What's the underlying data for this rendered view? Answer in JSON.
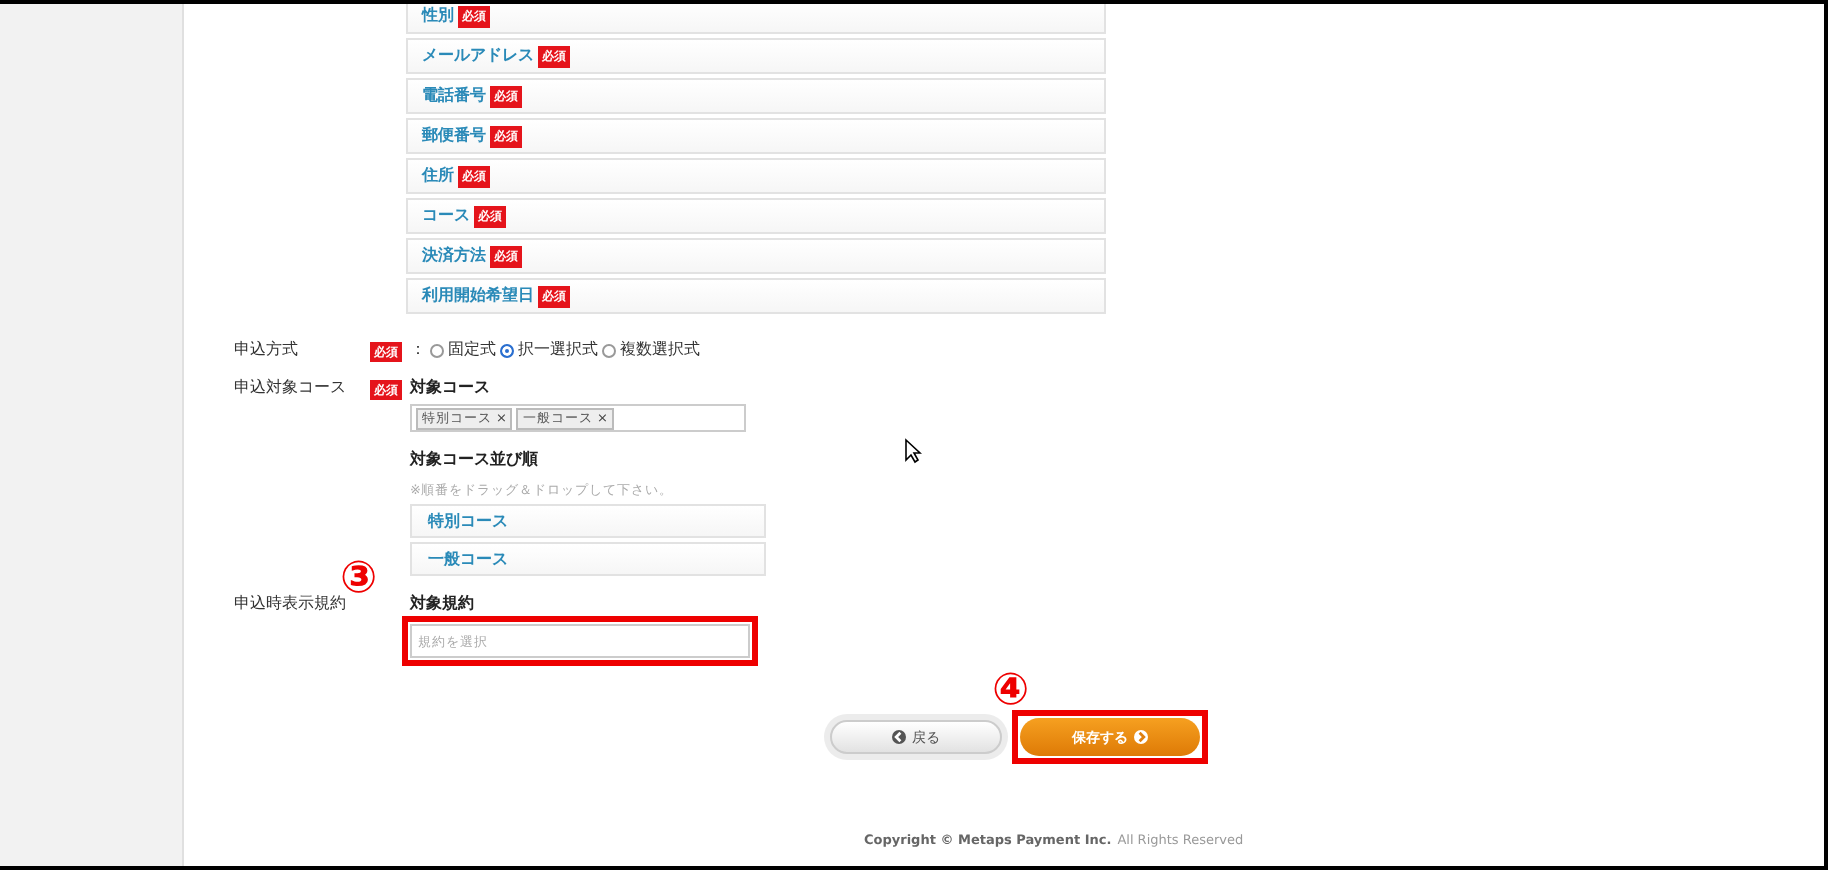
{
  "field_list": [
    {
      "label": "性別",
      "badge": "必須"
    },
    {
      "label": "メールアドレス",
      "badge": "必須"
    },
    {
      "label": "電話番号",
      "badge": "必須"
    },
    {
      "label": "郵便番号",
      "badge": "必須"
    },
    {
      "label": "住所",
      "badge": "必須"
    },
    {
      "label": "コース",
      "badge": "必須"
    },
    {
      "label": "決済方法",
      "badge": "必須"
    },
    {
      "label": "利用開始希望日",
      "badge": "必須"
    }
  ],
  "apply_method": {
    "label": "申込方式",
    "badge": "必須",
    "prefix": "：",
    "options": [
      {
        "label": "固定式",
        "selected": false
      },
      {
        "label": "択一選択式",
        "selected": true
      },
      {
        "label": "複数選択式",
        "selected": false
      }
    ]
  },
  "target_courses": {
    "label": "申込対象コース",
    "badge": "必須",
    "heading": "対象コース",
    "tags": [
      {
        "label": "特別コース",
        "remove": "×"
      },
      {
        "label": "一般コース",
        "remove": "×"
      }
    ],
    "order_heading": "対象コース並び順",
    "order_hint": "※順番をドラッグ＆ドロップして下さい。",
    "order_items": [
      "特別コース",
      "一般コース"
    ]
  },
  "terms": {
    "label": "申込時表示規約",
    "heading": "対象規約",
    "placeholder": "規約を選択",
    "highlighted": true,
    "marker": "③"
  },
  "buttons": {
    "back": "戻る",
    "save": "保存する",
    "save_highlighted": true,
    "marker": "④"
  },
  "footer": {
    "brand": "Copyright © Metaps Payment Inc.",
    "rights": "All Rights Reserved"
  }
}
